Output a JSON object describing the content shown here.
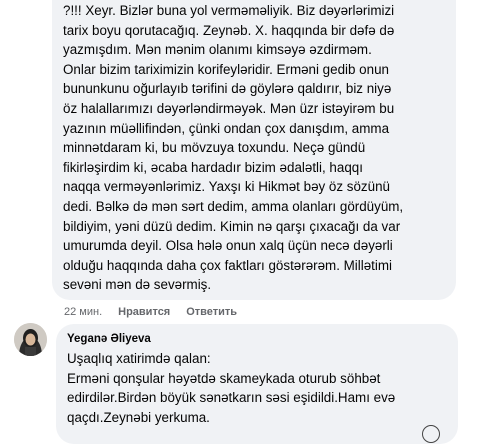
{
  "comment1": {
    "text": "?!!! Xeyr. Bizlər buna yol verməməliyik. Biz dəyərlərimizi\ntarix boyu qorutacağıq. Zeynəb. X. haqqında bir dəfə də\nyazmışdım. Mən mənim olanımı kimsəyə əzdirməm.\nOnlar bizim tariximizin korifeyləridir. Erməni gedib onun\nbununkunu oğurlayıb tərifini də göylərə qaldırır, biz niyə\nöz halallarımızı dəyərləndirməyək. Mən üzr istəyirəm bu\nyazının müəllifindən, çünki ondan çox danışdım, amma\nminnətdaram ki, bu mövzuya toxundu. Neçə gündü\nfikirləşirdim ki, əcaba hardadır bizim ədalətli, haqqı\nnaqqa verməyənlərimiz. Yaxşı ki Hikmət bəy öz sözünü\ndedi. Bəlkə də mən sərt dedim, amma olanları gördüyüm,\nbildiyim, yəni düzü dedim. Kimin nə qarşı çıxacağı da var\numurumda deyil. Olsa hələ onun xalq üçün necə dəyərli\nolduğu haqqında daha çox faktları göstərərəm. Millətimi\nsevəni mən də sevərmiş.",
    "time": "22 мин.",
    "like_label": "Нравится",
    "reply_label": "Ответить"
  },
  "comment2": {
    "author": "Yeganə Əliyeva",
    "text": "Uşaqlıq xatirimdə qalan:\nErməni qonşular həyətdə skameykada oturub söhbət\nedirdilər.Birdən böyük sənətkarın səsi eşidildi.Hamı evə\nqaçdı.Zeynəbi yerkuma."
  },
  "icons": {
    "avatar": "user-avatar",
    "corner": "smiley-icon"
  }
}
